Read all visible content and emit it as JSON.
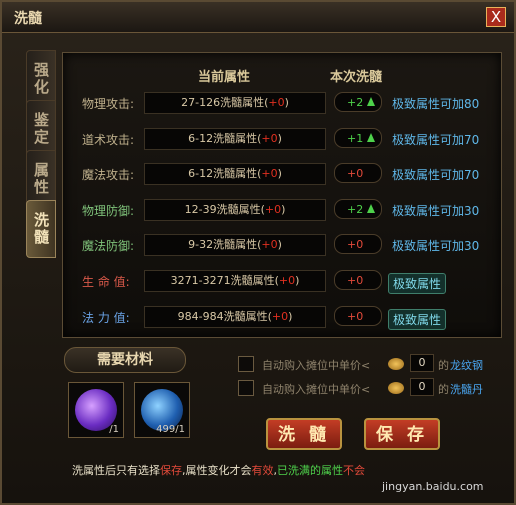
{
  "window": {
    "title": "洗髓",
    "close_label": "X"
  },
  "tabs": [
    {
      "label": "强化",
      "active": false
    },
    {
      "label": "鉴定",
      "active": false
    },
    {
      "label": "属性",
      "active": false
    },
    {
      "label": "洗髓",
      "active": true
    }
  ],
  "headers": {
    "current": "当前属性",
    "this_time": "本次洗髓"
  },
  "rows": [
    {
      "label": "物理攻击:",
      "label_color": "#bfb08c",
      "value": "27-126洗髓属性(",
      "bonus": "+0",
      "change": "+2",
      "change_up": true,
      "extra": "极致属性可加80",
      "badge": false
    },
    {
      "label": "道术攻击:",
      "label_color": "#bfb08c",
      "value": "6-12洗髓属性(",
      "bonus": "+0",
      "change": "+1",
      "change_up": true,
      "extra": "极致属性可加70",
      "badge": false
    },
    {
      "label": "魔法攻击:",
      "label_color": "#bfb08c",
      "value": "6-12洗髓属性(",
      "bonus": "+0",
      "change": "+0",
      "change_up": false,
      "extra": "极致属性可加70",
      "badge": false
    },
    {
      "label": "物理防御:",
      "label_color": "#7fc27a",
      "value": "12-39洗髓属性(",
      "bonus": "+0",
      "change": "+2",
      "change_up": true,
      "extra": "极致属性可加30",
      "badge": false
    },
    {
      "label": "魔法防御:",
      "label_color": "#7fc27a",
      "value": "9-32洗髓属性(",
      "bonus": "+0",
      "change": "+0",
      "change_up": false,
      "extra": "极致属性可加30",
      "badge": false
    },
    {
      "label": "生 命 值:",
      "label_color": "#d9594a",
      "value": "3271-3271洗髓属性(",
      "bonus": "+0",
      "change": "+0",
      "change_up": false,
      "extra": "极致属性",
      "badge": true
    },
    {
      "label": "法 力 值:",
      "label_color": "#6aa3e6",
      "value": "984-984洗髓属性(",
      "bonus": "+0",
      "change": "+0",
      "change_up": false,
      "extra": "极致属性",
      "badge": true
    }
  ],
  "materials": {
    "header": "需要材料",
    "slots": [
      {
        "count": "/1"
      },
      {
        "count": "499/1"
      }
    ]
  },
  "auto_buy": [
    {
      "text": "自动购入摊位中单价<",
      "qty": "0",
      "unit": "的",
      "item": "龙纹钢"
    },
    {
      "text": "自动购入摊位中单价<",
      "qty": "0",
      "unit": "的",
      "item": "洗髓丹"
    }
  ],
  "buttons": {
    "refine": "洗 髓",
    "save": "保 存"
  },
  "notice": {
    "p1": "洗属性后只有选择",
    "p2": "保存",
    "p3": ",属性变化才会",
    "p4": "有效",
    "p5": ",",
    "p6": "已洗满的属性",
    "p7": "不会"
  },
  "watermark": "jingyan.baidu.com"
}
